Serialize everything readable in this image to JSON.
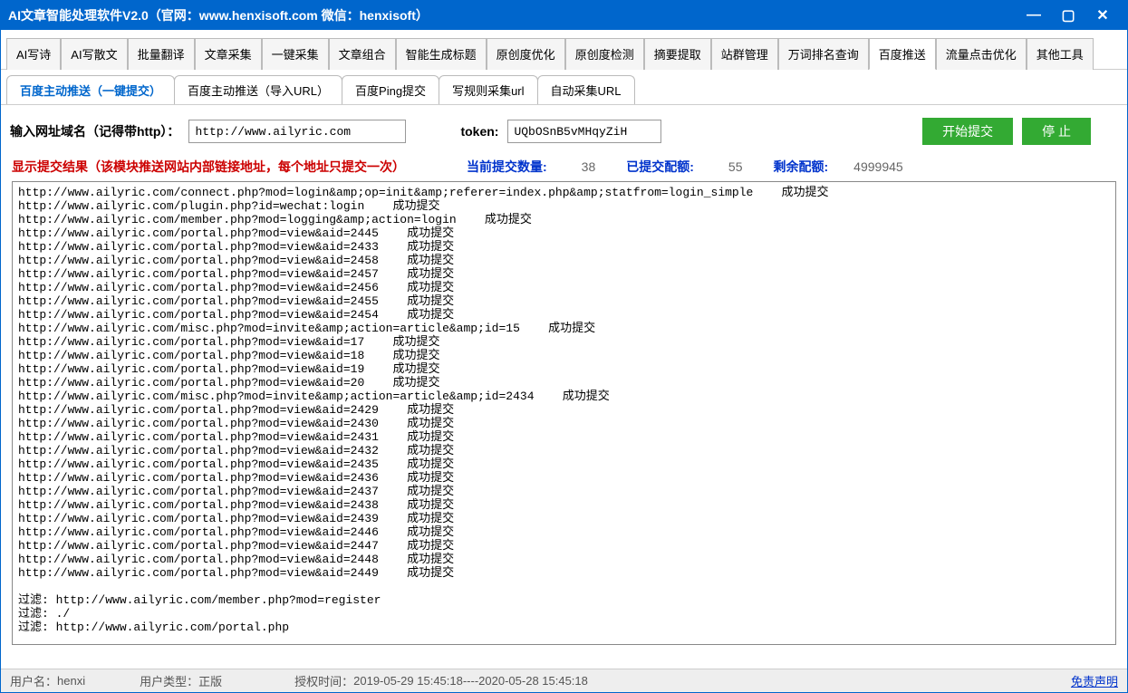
{
  "titlebar": {
    "title": "AI文章智能处理软件V2.0（官网：www.henxisoft.com  微信：henxisoft）"
  },
  "main_tabs": [
    {
      "label": "AI写诗"
    },
    {
      "label": "AI写散文"
    },
    {
      "label": "批量翻译"
    },
    {
      "label": "文章采集"
    },
    {
      "label": "一键采集"
    },
    {
      "label": "文章组合"
    },
    {
      "label": "智能生成标题"
    },
    {
      "label": "原创度优化"
    },
    {
      "label": "原创度检测"
    },
    {
      "label": "摘要提取"
    },
    {
      "label": "站群管理"
    },
    {
      "label": "万词排名查询"
    },
    {
      "label": "百度推送",
      "active": true
    },
    {
      "label": "流量点击优化"
    },
    {
      "label": "其他工具"
    }
  ],
  "sub_tabs": [
    {
      "label": "百度主动推送（一键提交）",
      "active": true
    },
    {
      "label": "百度主动推送（导入URL）"
    },
    {
      "label": "百度Ping提交"
    },
    {
      "label": "写规则采集url"
    },
    {
      "label": "自动采集URL"
    }
  ],
  "form": {
    "domain_label": "输入网址域名（记得带http）：",
    "domain_value": "http://www.ailyric.com",
    "token_label": "token:",
    "token_value": "UQbOSnB5vMHqyZiH",
    "start_btn": "开始提交",
    "stop_btn": "停  止"
  },
  "stats": {
    "result_label": "显示提交结果（该模块推送网站内部链接地址，每个地址只提交一次）",
    "current_label": "当前提交数量:",
    "current_value": "38",
    "submitted_label": "已提交配额:",
    "submitted_value": "55",
    "remain_label": "剩余配额:",
    "remain_value": "4999945"
  },
  "log_lines": [
    "http://www.ailyric.com/connect.php?mod=login&amp;op=init&amp;referer=index.php&amp;statfrom=login_simple    成功提交",
    "http://www.ailyric.com/plugin.php?id=wechat:login    成功提交",
    "http://www.ailyric.com/member.php?mod=logging&amp;action=login    成功提交",
    "http://www.ailyric.com/portal.php?mod=view&aid=2445    成功提交",
    "http://www.ailyric.com/portal.php?mod=view&aid=2433    成功提交",
    "http://www.ailyric.com/portal.php?mod=view&aid=2458    成功提交",
    "http://www.ailyric.com/portal.php?mod=view&aid=2457    成功提交",
    "http://www.ailyric.com/portal.php?mod=view&aid=2456    成功提交",
    "http://www.ailyric.com/portal.php?mod=view&aid=2455    成功提交",
    "http://www.ailyric.com/portal.php?mod=view&aid=2454    成功提交",
    "http://www.ailyric.com/misc.php?mod=invite&amp;action=article&amp;id=15    成功提交",
    "http://www.ailyric.com/portal.php?mod=view&aid=17    成功提交",
    "http://www.ailyric.com/portal.php?mod=view&aid=18    成功提交",
    "http://www.ailyric.com/portal.php?mod=view&aid=19    成功提交",
    "http://www.ailyric.com/portal.php?mod=view&aid=20    成功提交",
    "http://www.ailyric.com/misc.php?mod=invite&amp;action=article&amp;id=2434    成功提交",
    "http://www.ailyric.com/portal.php?mod=view&aid=2429    成功提交",
    "http://www.ailyric.com/portal.php?mod=view&aid=2430    成功提交",
    "http://www.ailyric.com/portal.php?mod=view&aid=2431    成功提交",
    "http://www.ailyric.com/portal.php?mod=view&aid=2432    成功提交",
    "http://www.ailyric.com/portal.php?mod=view&aid=2435    成功提交",
    "http://www.ailyric.com/portal.php?mod=view&aid=2436    成功提交",
    "http://www.ailyric.com/portal.php?mod=view&aid=2437    成功提交",
    "http://www.ailyric.com/portal.php?mod=view&aid=2438    成功提交",
    "http://www.ailyric.com/portal.php?mod=view&aid=2439    成功提交",
    "http://www.ailyric.com/portal.php?mod=view&aid=2446    成功提交",
    "http://www.ailyric.com/portal.php?mod=view&aid=2447    成功提交",
    "http://www.ailyric.com/portal.php?mod=view&aid=2448    成功提交",
    "http://www.ailyric.com/portal.php?mod=view&aid=2449    成功提交",
    "",
    "过滤: http://www.ailyric.com/member.php?mod=register",
    "过滤: ./",
    "过滤: http://www.ailyric.com/portal.php"
  ],
  "status": {
    "user_label": "用户名：",
    "user_value": "henxi",
    "type_label": "用户类型：",
    "type_value": "正版",
    "auth_label": "授权时间：",
    "auth_value": "2019-05-29 15:45:18----2020-05-28 15:45:18",
    "disclaimer": "免责声明"
  }
}
